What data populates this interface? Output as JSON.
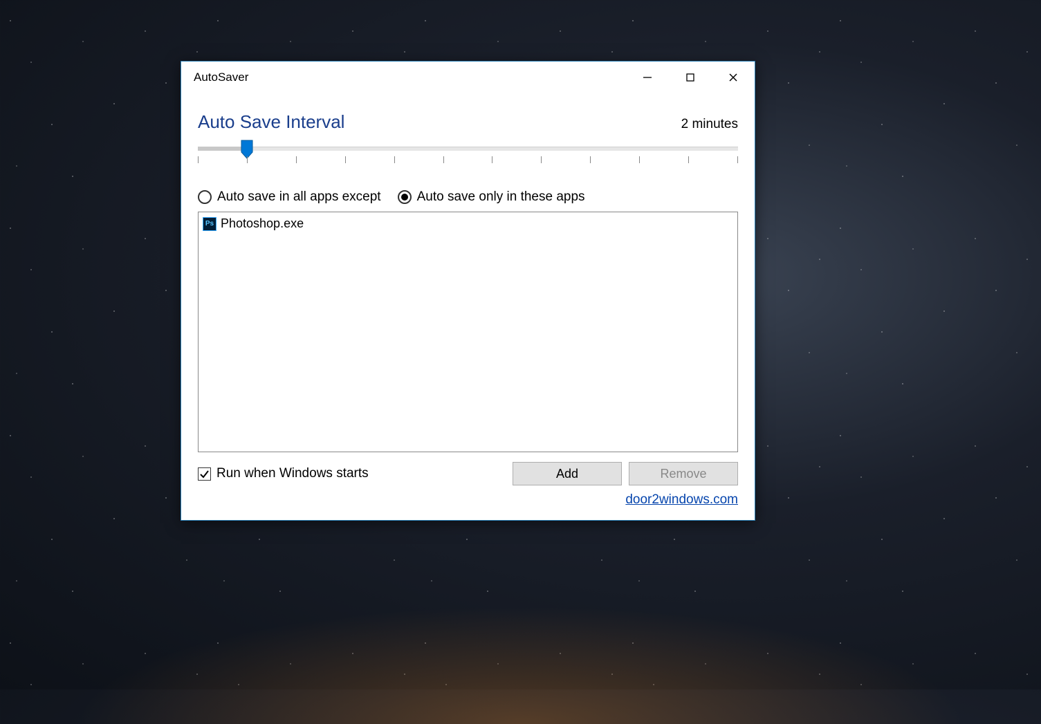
{
  "window": {
    "title": "AutoSaver"
  },
  "interval": {
    "heading": "Auto Save Interval",
    "value_text": "2 minutes",
    "slider": {
      "min": 1,
      "max": 12,
      "value": 2,
      "tick_count": 12
    }
  },
  "mode": {
    "except_label": "Auto save in all apps except",
    "only_label": "Auto save only in these apps",
    "selected": "only"
  },
  "apps": [
    {
      "name": "Photoshop.exe",
      "icon": "photoshop-icon"
    }
  ],
  "startup": {
    "label": "Run when Windows starts",
    "checked": true
  },
  "buttons": {
    "add": "Add",
    "remove": "Remove",
    "remove_disabled": true
  },
  "link": {
    "text": "door2windows.com"
  }
}
